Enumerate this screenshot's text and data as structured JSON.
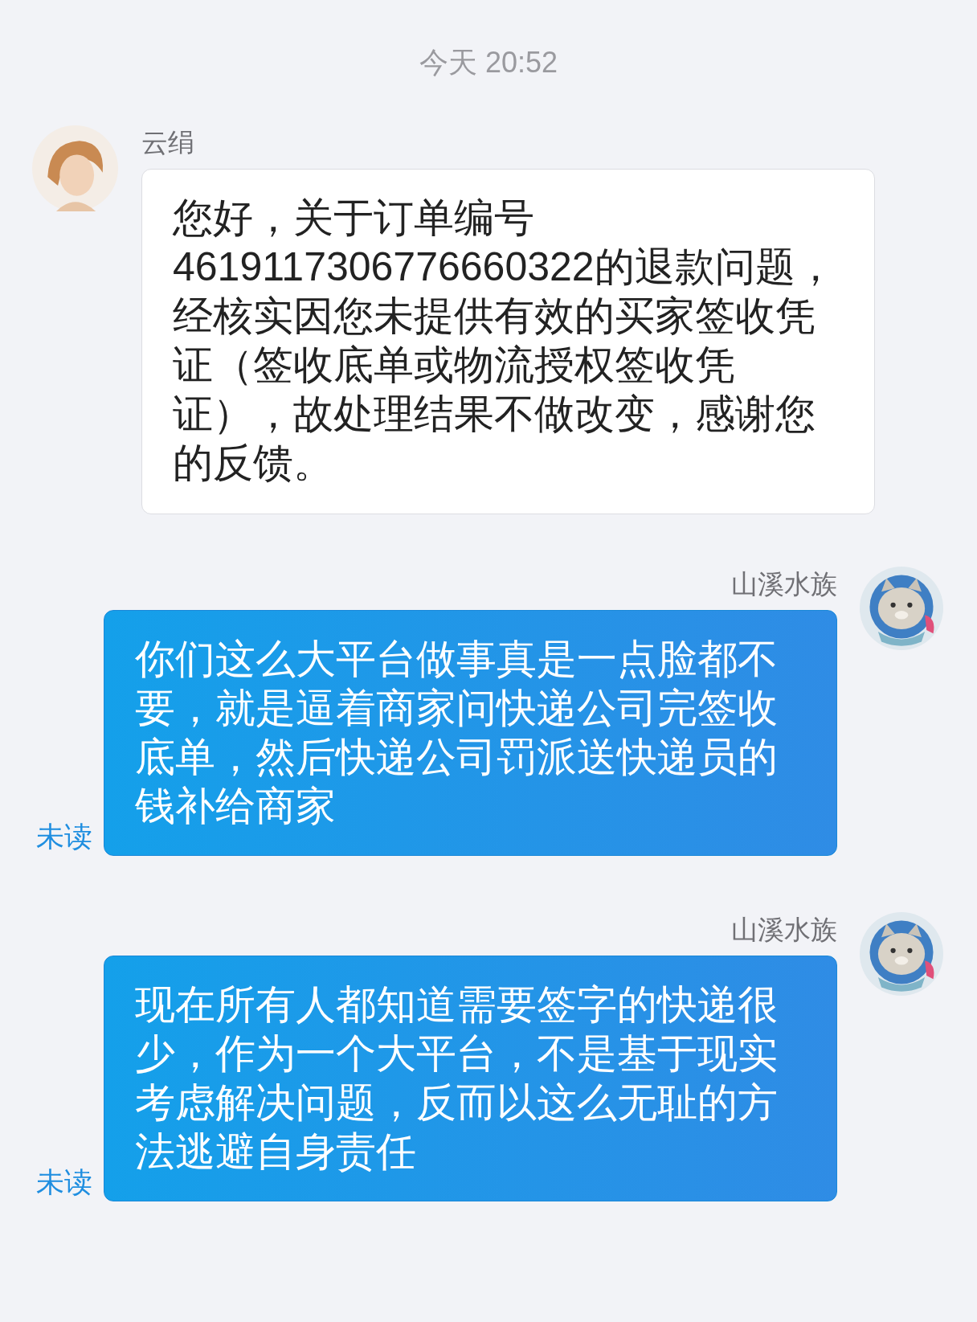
{
  "timestamp": "今天  20:52",
  "messages": [
    {
      "kind": "incoming",
      "sender": "云绢",
      "text": "您好，关于订单编号4619117306776660322的退款问题，经核实因您未提供有效的买家签收凭证（签收底单或物流授权签收凭证），故处理结果不做改变，感谢您的反馈。"
    },
    {
      "kind": "outgoing",
      "sender": "山溪水族",
      "text": "你们这么大平台做事真是一点脸都不要，就是逼着商家问快递公司完签收底单，然后快递公司罚派送快递员的钱补给商家",
      "status": "未读"
    },
    {
      "kind": "outgoing",
      "sender": "山溪水族",
      "text": "现在所有人都知道需要签字的快递很少，作为一个大平台，不是基于现实考虑解决问题，反而以这么无耻的方法逃避自身责任",
      "status": "未读"
    }
  ]
}
